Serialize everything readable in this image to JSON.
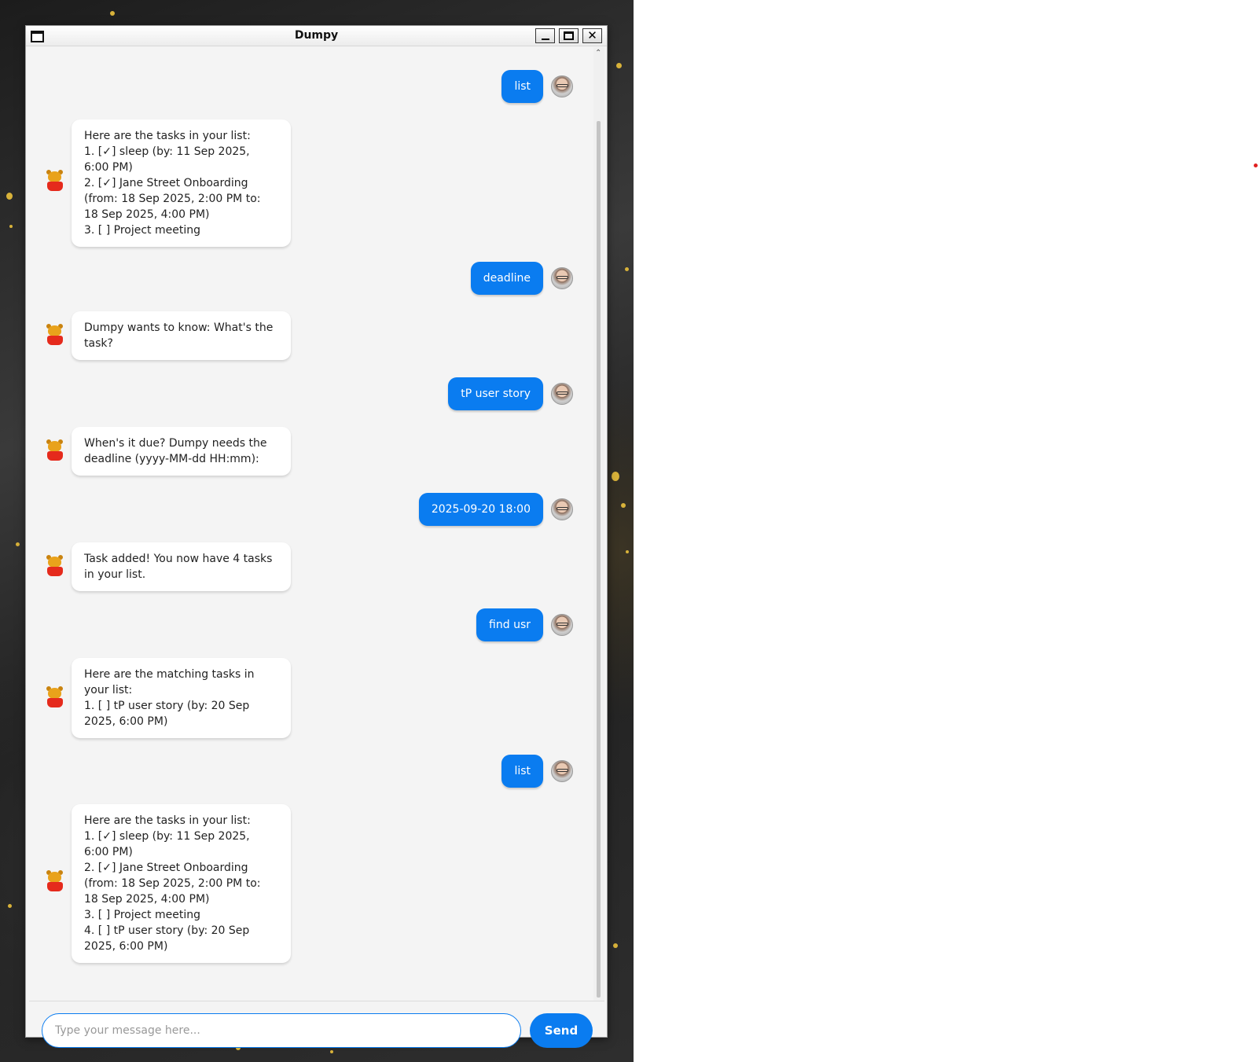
{
  "window": {
    "title": "Dumpy",
    "minimize_icon": "minimize-icon",
    "maximize_icon": "maximize-icon",
    "close_icon": "close-icon"
  },
  "messages": [
    {
      "sender": "user",
      "text": "list"
    },
    {
      "sender": "bot",
      "text": "Here are the tasks in your list:\n1. [✓]  sleep (by: 11 Sep 2025,\n6:00 PM)\n2. [✓]  Jane Street Onboarding\n(from: 18 Sep 2025, 2:00 PM to:\n18 Sep 2025, 4:00 PM)\n3. [  ]  Project meeting"
    },
    {
      "sender": "user",
      "text": "deadline"
    },
    {
      "sender": "bot",
      "text": "Dumpy wants to know: What's the\ntask?"
    },
    {
      "sender": "user",
      "text": "tP user story"
    },
    {
      "sender": "bot",
      "text": "When's it due? Dumpy needs the\ndeadline (yyyy-MM-dd HH:mm):"
    },
    {
      "sender": "user",
      "text": "2025-09-20 18:00"
    },
    {
      "sender": "bot",
      "text": "Task added! You now have 4 tasks\nin your list."
    },
    {
      "sender": "user",
      "text": "find usr"
    },
    {
      "sender": "bot",
      "text": "Here are the matching tasks in\nyour list:\n1. [  ]  tP user story (by: 20 Sep\n2025, 6:00 PM)"
    },
    {
      "sender": "user",
      "text": "list"
    },
    {
      "sender": "bot",
      "text": "Here are the tasks in your list:\n1. [✓]  sleep (by: 11 Sep 2025,\n6:00 PM)\n2. [✓]  Jane Street Onboarding\n(from: 18 Sep 2025, 2:00 PM to:\n18 Sep 2025, 4:00 PM)\n3. [  ]  Project meeting\n4. [  ]  tP user story (by: 20 Sep\n2025, 6:00 PM)"
    }
  ],
  "input": {
    "placeholder": "Type your message here...",
    "value": ""
  },
  "send_button": {
    "label": "Send"
  },
  "colors": {
    "accent": "#0a7cf0",
    "bot_bubble": "#ffffff",
    "chat_background": "#f4f4f4"
  }
}
